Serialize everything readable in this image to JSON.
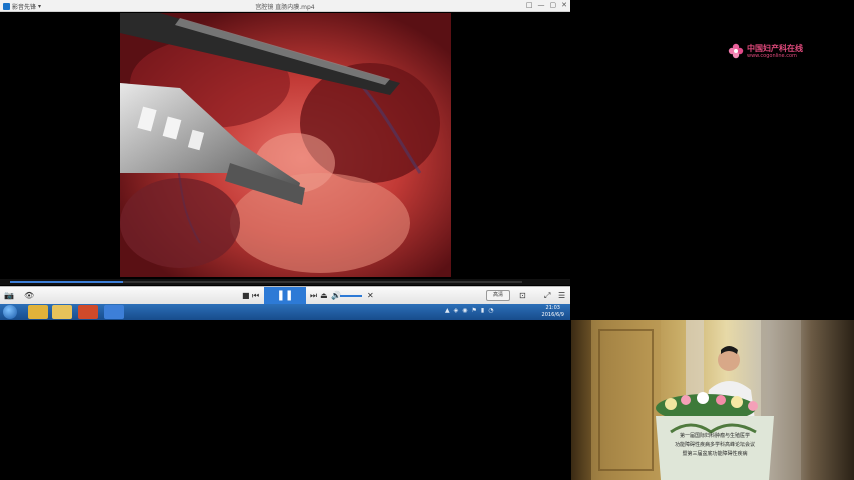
{
  "player": {
    "app_name": "影音先锋",
    "file_name": "宫腔镜 直肠内膜.mp4",
    "window_controls": [
      "□",
      "—",
      "▢",
      "✕"
    ]
  },
  "controls": {
    "play_pause_glyph": "❚❚",
    "quality_label": "高清",
    "progress": 0.22
  },
  "taskbar": {
    "clock_time": "21:03",
    "clock_date": "2016/6/9",
    "apps": [
      {
        "name": "chrome",
        "color": "#e0b23a"
      },
      {
        "name": "file-explorer",
        "color": "#e6c25a"
      },
      {
        "name": "powerpoint",
        "color": "#d04a2a"
      },
      {
        "name": "media-player",
        "color": "#3d7fd8"
      }
    ]
  },
  "logo": {
    "name": "中国妇产科在线",
    "url": "www.cogonline.com"
  },
  "banner": {
    "lines": [
      "第一届国际妇科肿瘤与生殖医学",
      "功能障碍性疾病多学科高峰论坛会议",
      "暨第三届盆底功能障碍性疾病"
    ]
  }
}
